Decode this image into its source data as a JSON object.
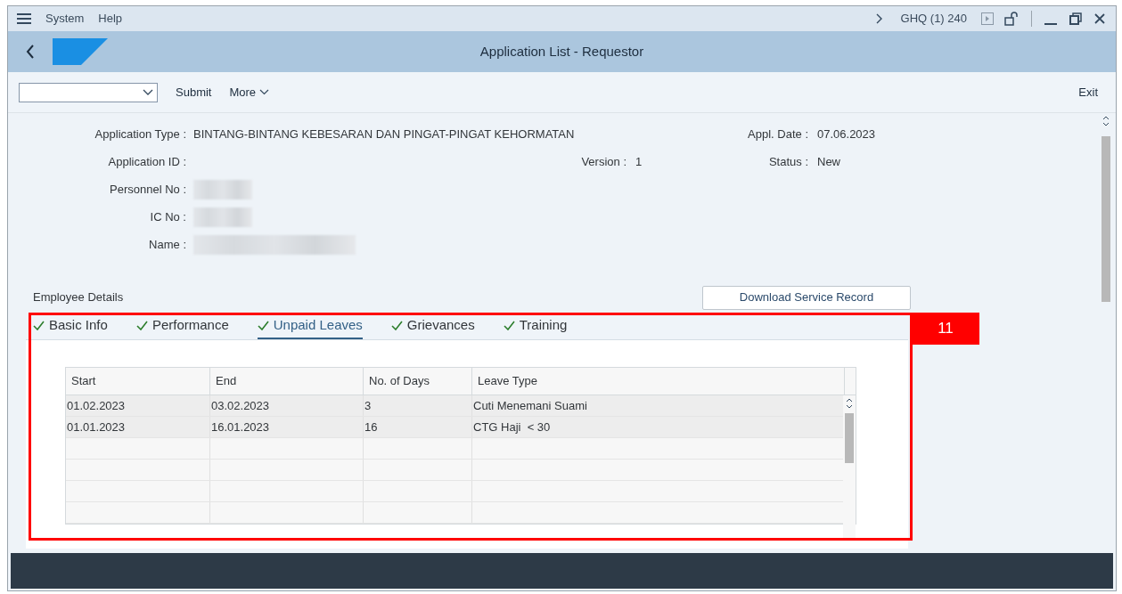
{
  "menu_bar": {
    "items": [
      {
        "label": "System"
      },
      {
        "label": "Help"
      }
    ],
    "system_info": "GHQ (1) 240"
  },
  "title_bar": {
    "title": "Application List - Requestor"
  },
  "toolbar": {
    "buttons": [
      "Submit",
      "More"
    ],
    "exit": "Exit"
  },
  "form": {
    "left": [
      {
        "label": "Application Type :",
        "value": "BINTANG-BINTANG KEBESARAN DAN PINGAT-PINGAT KEHORMATAN",
        "redacted": false
      },
      {
        "label": "Application ID :",
        "redacted": false
      },
      {
        "label": "Personnel No :",
        "redacted": true
      },
      {
        "label": "IC No :",
        "redacted": true
      },
      {
        "label": "Name :",
        "redacted": true
      }
    ],
    "version": {
      "label": "Version :",
      "value": "1"
    },
    "right": [
      {
        "label": "Appl. Date :",
        "value": "07.06.2023"
      },
      {
        "label": "Status :",
        "value": "New"
      }
    ]
  },
  "section": {
    "title": "Employee Details",
    "button": "Download Service Record"
  },
  "tabs": [
    {
      "label": "Basic Info",
      "checked": true,
      "selected": false
    },
    {
      "label": "Performance",
      "checked": true,
      "selected": false
    },
    {
      "label": "Unpaid Leaves",
      "checked": true,
      "selected": true
    },
    {
      "label": "Grievances",
      "checked": true,
      "selected": false
    },
    {
      "label": "Training",
      "checked": true,
      "selected": false
    }
  ],
  "table": {
    "columns": [
      "Start",
      "End",
      "No. of Days",
      "Leave Type"
    ],
    "rows": [
      [
        "01.02.2023",
        "03.02.2023",
        "3",
        "Cuti Menemani Suami"
      ],
      [
        "01.01.2023",
        "16.01.2023",
        "16",
        "CTG Haji  < 30"
      ]
    ]
  },
  "annotation": {
    "label": "11"
  }
}
